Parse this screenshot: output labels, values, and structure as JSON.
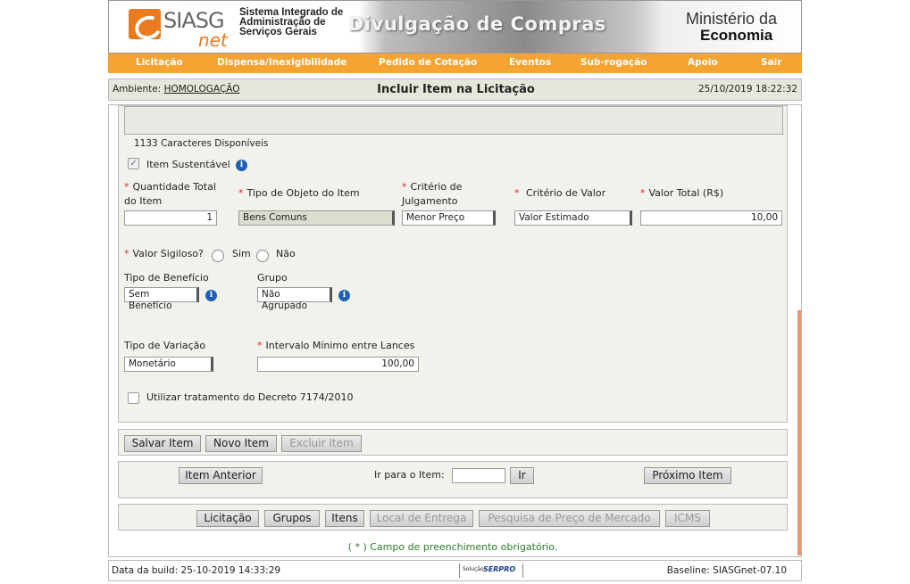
{
  "header": {
    "logo_main": "SIASG",
    "logo_net": "net",
    "system_name_line1": "Sistema Integrado de",
    "system_name_line2": "Administração de",
    "system_name_line3": "Serviços Gerais",
    "banner_title": "Divulgação de Compras",
    "ministry_line1": "Ministério da",
    "ministry_line2": "Economia"
  },
  "menu": [
    "Licitação",
    "Dispensa/Inexigibilidade",
    "Pedido de Cotação",
    "Eventos",
    "Sub-rogação",
    "Apoio",
    "Sair"
  ],
  "env": {
    "label": "Ambiente: ",
    "value": "HOMOLOGAÇÃO",
    "title": "Incluir Item na Licitação",
    "datetime": "25/10/2019 18:22:32"
  },
  "form": {
    "chars_count": "1133",
    "chars_label": "Caracteres Disponíveis",
    "sustentavel_label": "Item Sustentável",
    "quantidade_label_1": "Quantidade Total",
    "quantidade_label_2": "do Item",
    "quantidade_value": "1",
    "tipo_objeto_label": "Tipo de Objeto do Item",
    "tipo_objeto_value": "Bens Comuns",
    "criterio_julg_label_1": "Critério de",
    "criterio_julg_label_2": "Julgamento",
    "criterio_julg_value": "Menor Preço",
    "criterio_valor_label": "Critério de Valor",
    "criterio_valor_value": "Valor Estimado",
    "valor_total_label": "Valor Total (R$)",
    "valor_total_value": "10,00",
    "valor_sigiloso_label": "Valor Sigiloso?",
    "sim_label": "Sim",
    "nao_label": "Não",
    "tipo_beneficio_label": "Tipo de Benefício",
    "tipo_beneficio_value": "Sem Benefício",
    "grupo_label": "Grupo",
    "grupo_value": "Não Agrupado",
    "tipo_variacao_label": "Tipo de Variação",
    "tipo_variacao_value": "Monetário",
    "intervalo_label": "Intervalo Mínimo entre Lances",
    "intervalo_value": "100,00",
    "decreto_label": "Utilizar tratamento do Decreto 7174/2010",
    "required_mark": "*"
  },
  "actions": {
    "salvar": "Salvar Item",
    "novo": "Novo Item",
    "excluir": "Excluir Item"
  },
  "nav": {
    "anterior": "Item Anterior",
    "ir_para_label": "Ir para o Item:",
    "ir_value": "",
    "ir": "Ir",
    "proximo": "Próximo Item"
  },
  "tabs": {
    "licitacao": "Licitação",
    "grupos": "Grupos",
    "itens": "Itens",
    "local": "Local de Entrega",
    "pesquisa": "Pesquisa de Preço de Mercado",
    "icms": "ICMS"
  },
  "required_note": "( * ) Campo de preenchimento obrigatório.",
  "required_note_star": "*",
  "footer": {
    "build": "Data da build: 25-10-2019 14:33:29",
    "serpro_prefix": "Solução",
    "serpro": "SERPRO",
    "baseline": "Baseline: SIASGnet-07.10"
  },
  "colors": {
    "menu": "#f5a331",
    "accent": "#e97a1f",
    "required": "#dd2222",
    "note": "#2a7a2a"
  },
  "icons": [
    "info-icon",
    "checkbox-icon",
    "radio-icon",
    "select-arrow-icon"
  ]
}
